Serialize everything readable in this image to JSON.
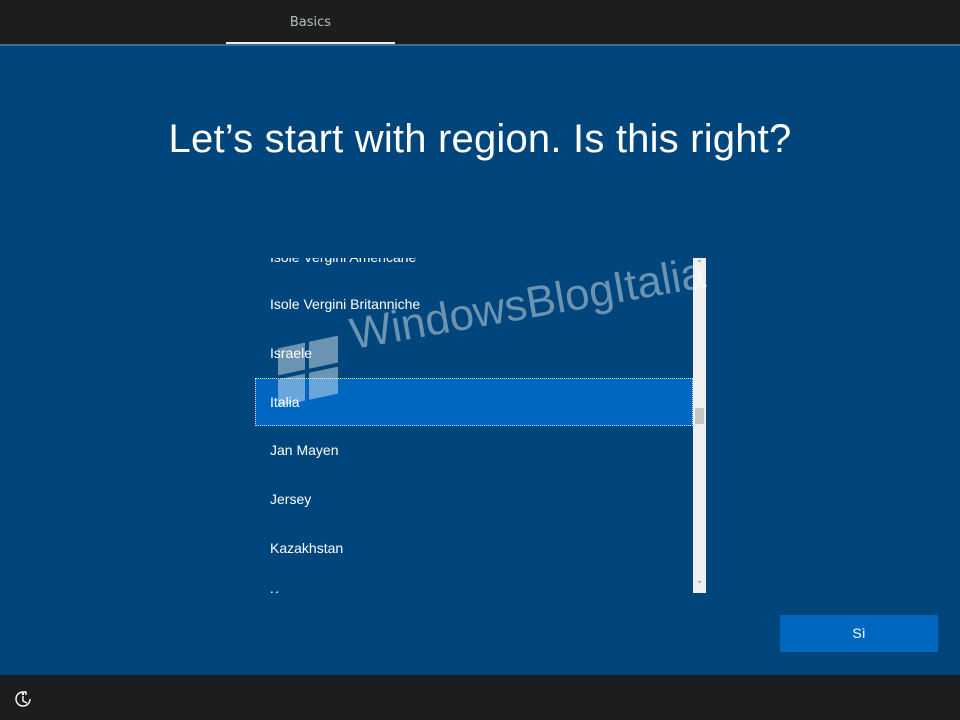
{
  "header": {
    "tab_label": "Basics"
  },
  "main": {
    "title": "Let’s start with region. Is this right?",
    "region_list": {
      "items": [
        "Isole Vergini Americane",
        "Isole Vergini Britanniche",
        "Israele",
        "Italia",
        "Jan Mayen",
        "Jersey",
        "Kazakhstan",
        "Kenya"
      ],
      "selected": "Italia"
    },
    "confirm_button": "Sì"
  },
  "watermark": {
    "text": "WindowsBlogItalia"
  },
  "footer": {
    "accessibility_icon": "accessibility-icon"
  },
  "colors": {
    "background": "#00457b",
    "accent": "#0067c0",
    "bar": "#1c1e1e"
  }
}
